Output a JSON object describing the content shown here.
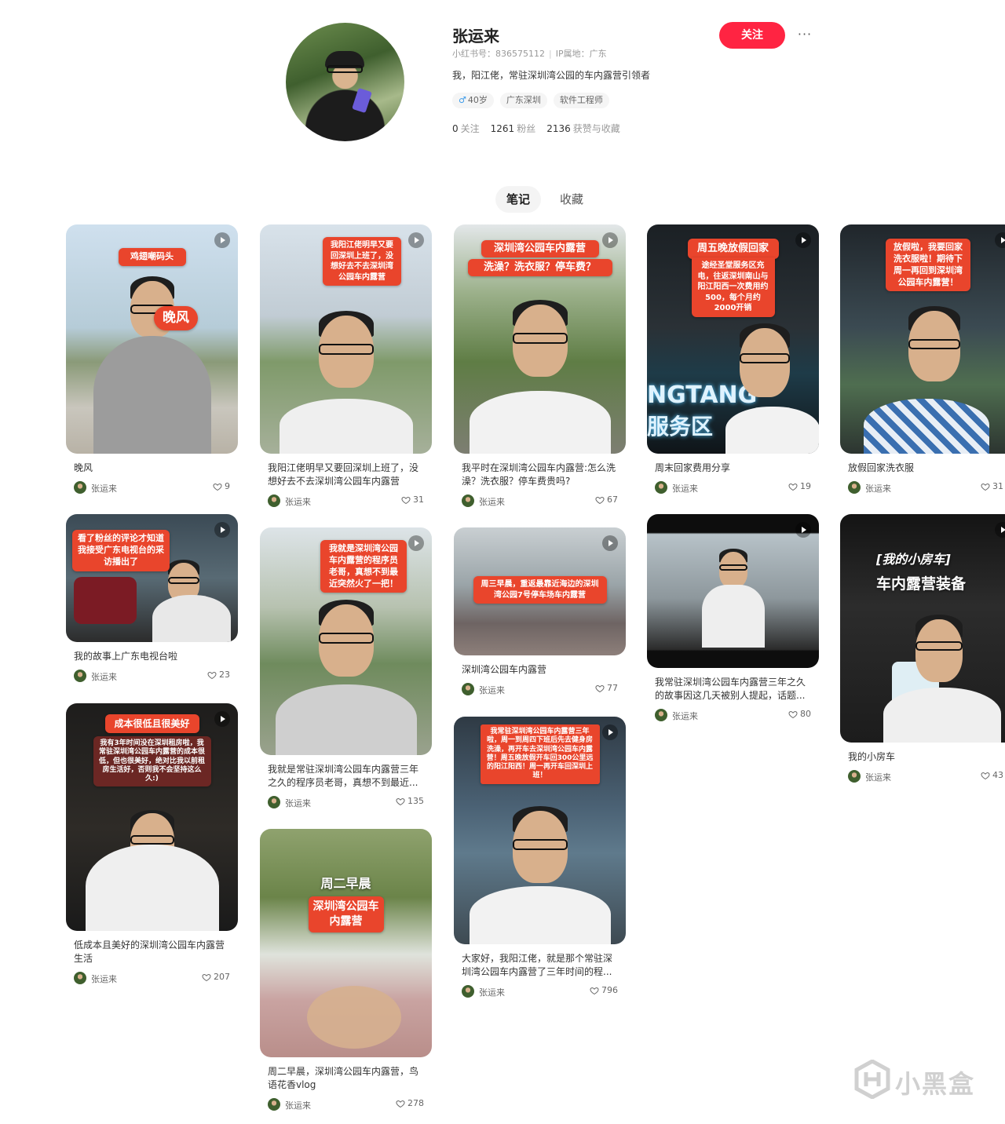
{
  "profile": {
    "name": "张运来",
    "xhs_id": "小红书号：836575112",
    "ip": "IP属地：广东",
    "bio": "我，阳江佬，常驻深圳湾公园的车内露营引领者",
    "tags": {
      "age": "40岁",
      "location": "广东深圳",
      "job": "软件工程师"
    },
    "stats": {
      "following_num": "0",
      "following_label": "关注",
      "fans_num": "1261",
      "fans_label": "粉丝",
      "likes_num": "2136",
      "likes_label": "获赞与收藏"
    },
    "follow_label": "关注",
    "more_label": "···"
  },
  "tabs": {
    "notes": "笔记",
    "collect": "收藏"
  },
  "notes": [
    {
      "title": "晚风",
      "author": "张运来",
      "likes": "9",
      "cover_text": [
        "鸡翅嘲码头",
        "晚风"
      ]
    },
    {
      "title": "我阳江佬明早又要回深圳上班了，没想好去不去深圳湾公园车内露营",
      "author": "张运来",
      "likes": "31",
      "cover_text": [
        "我阳江佬明早又要回深圳上班了，没想好去不去深圳湾公园车内露营"
      ]
    },
    {
      "title": "我平时在深圳湾公园车内露营:怎么洗澡？洗衣服？停车费贵吗?",
      "author": "张运来",
      "likes": "67",
      "cover_text": [
        "深圳湾公园车内露营",
        "洗澡？洗衣服？停车费？"
      ]
    },
    {
      "title": "周末回家费用分享",
      "author": "张运来",
      "likes": "19",
      "cover_text": [
        "周五晚放假回家",
        "途经圣堂服务区充电，往返深圳南山与阳江阳西一次费用约500，每个月约2000开销",
        "NGTANG",
        "服务区"
      ]
    },
    {
      "title": "放假回家洗衣服",
      "author": "张运来",
      "likes": "31",
      "cover_text": [
        "放假啦，我要回家洗衣服啦！期待下周一再回到深圳湾公园车内露营！"
      ]
    },
    {
      "title": "我的故事上广东电视台啦",
      "author": "张运来",
      "likes": "23",
      "cover_text": [
        "看了粉丝的评论才知道我接受广东电视台的采访播出了"
      ]
    },
    {
      "title": "我就是常驻深圳湾公园车内露营三年之久的程序员老哥，真想不到最近...",
      "author": "张运来",
      "likes": "135",
      "cover_text": [
        "我就是深圳湾公园车内露营的程序员老哥，真想不到最近突然火了一把！"
      ]
    },
    {
      "title": "深圳湾公园车内露营",
      "author": "张运来",
      "likes": "77",
      "cover_text": [
        "周三早晨，重返最靠近海边的深圳湾公园7号停车场车内露营"
      ]
    },
    {
      "title": "我常驻深圳湾公园车内露营三年之久的故事因这几天被别人提起，话题...",
      "author": "张运来",
      "likes": "80",
      "cover_text": []
    },
    {
      "title": "我的小房车",
      "author": "张运来",
      "likes": "43",
      "cover_text": [
        "[我的小房车]",
        "车内露营装备"
      ]
    },
    {
      "title": "低成本且美好的深圳湾公园车内露营生活",
      "author": "张运来",
      "likes": "207",
      "cover_text": [
        "成本很低且很美好",
        "我有3年时间没在深圳租房啦，我常驻深圳湾公园车内露营的成本很低，但也很美好，绝对比我以前租房生活好，否则我不会坚持这么久:)"
      ]
    },
    {
      "title": "周二早晨，深圳湾公园车内露营，鸟语花香vlog",
      "author": "张运来",
      "likes": "278",
      "cover_text": [
        "周二早晨",
        "深圳湾公园车内露营"
      ]
    },
    {
      "title": "大家好，我阳江佬，就是那个常驻深圳湾公园车内露营了三年时间的程...",
      "author": "张运来",
      "likes": "796",
      "cover_text": [
        "我常驻深圳湾公园车内露营三年啦，周一到周四下班后先去健身房洗澡，再开车去深圳湾公园车内露营！周五晚放假开车回300公里远的阳江阳西！周一再开车回深圳上班！"
      ]
    }
  ],
  "watermark": "小黑盒",
  "colors": {
    "brand": "#ff2442",
    "banner": "#e9452c"
  }
}
